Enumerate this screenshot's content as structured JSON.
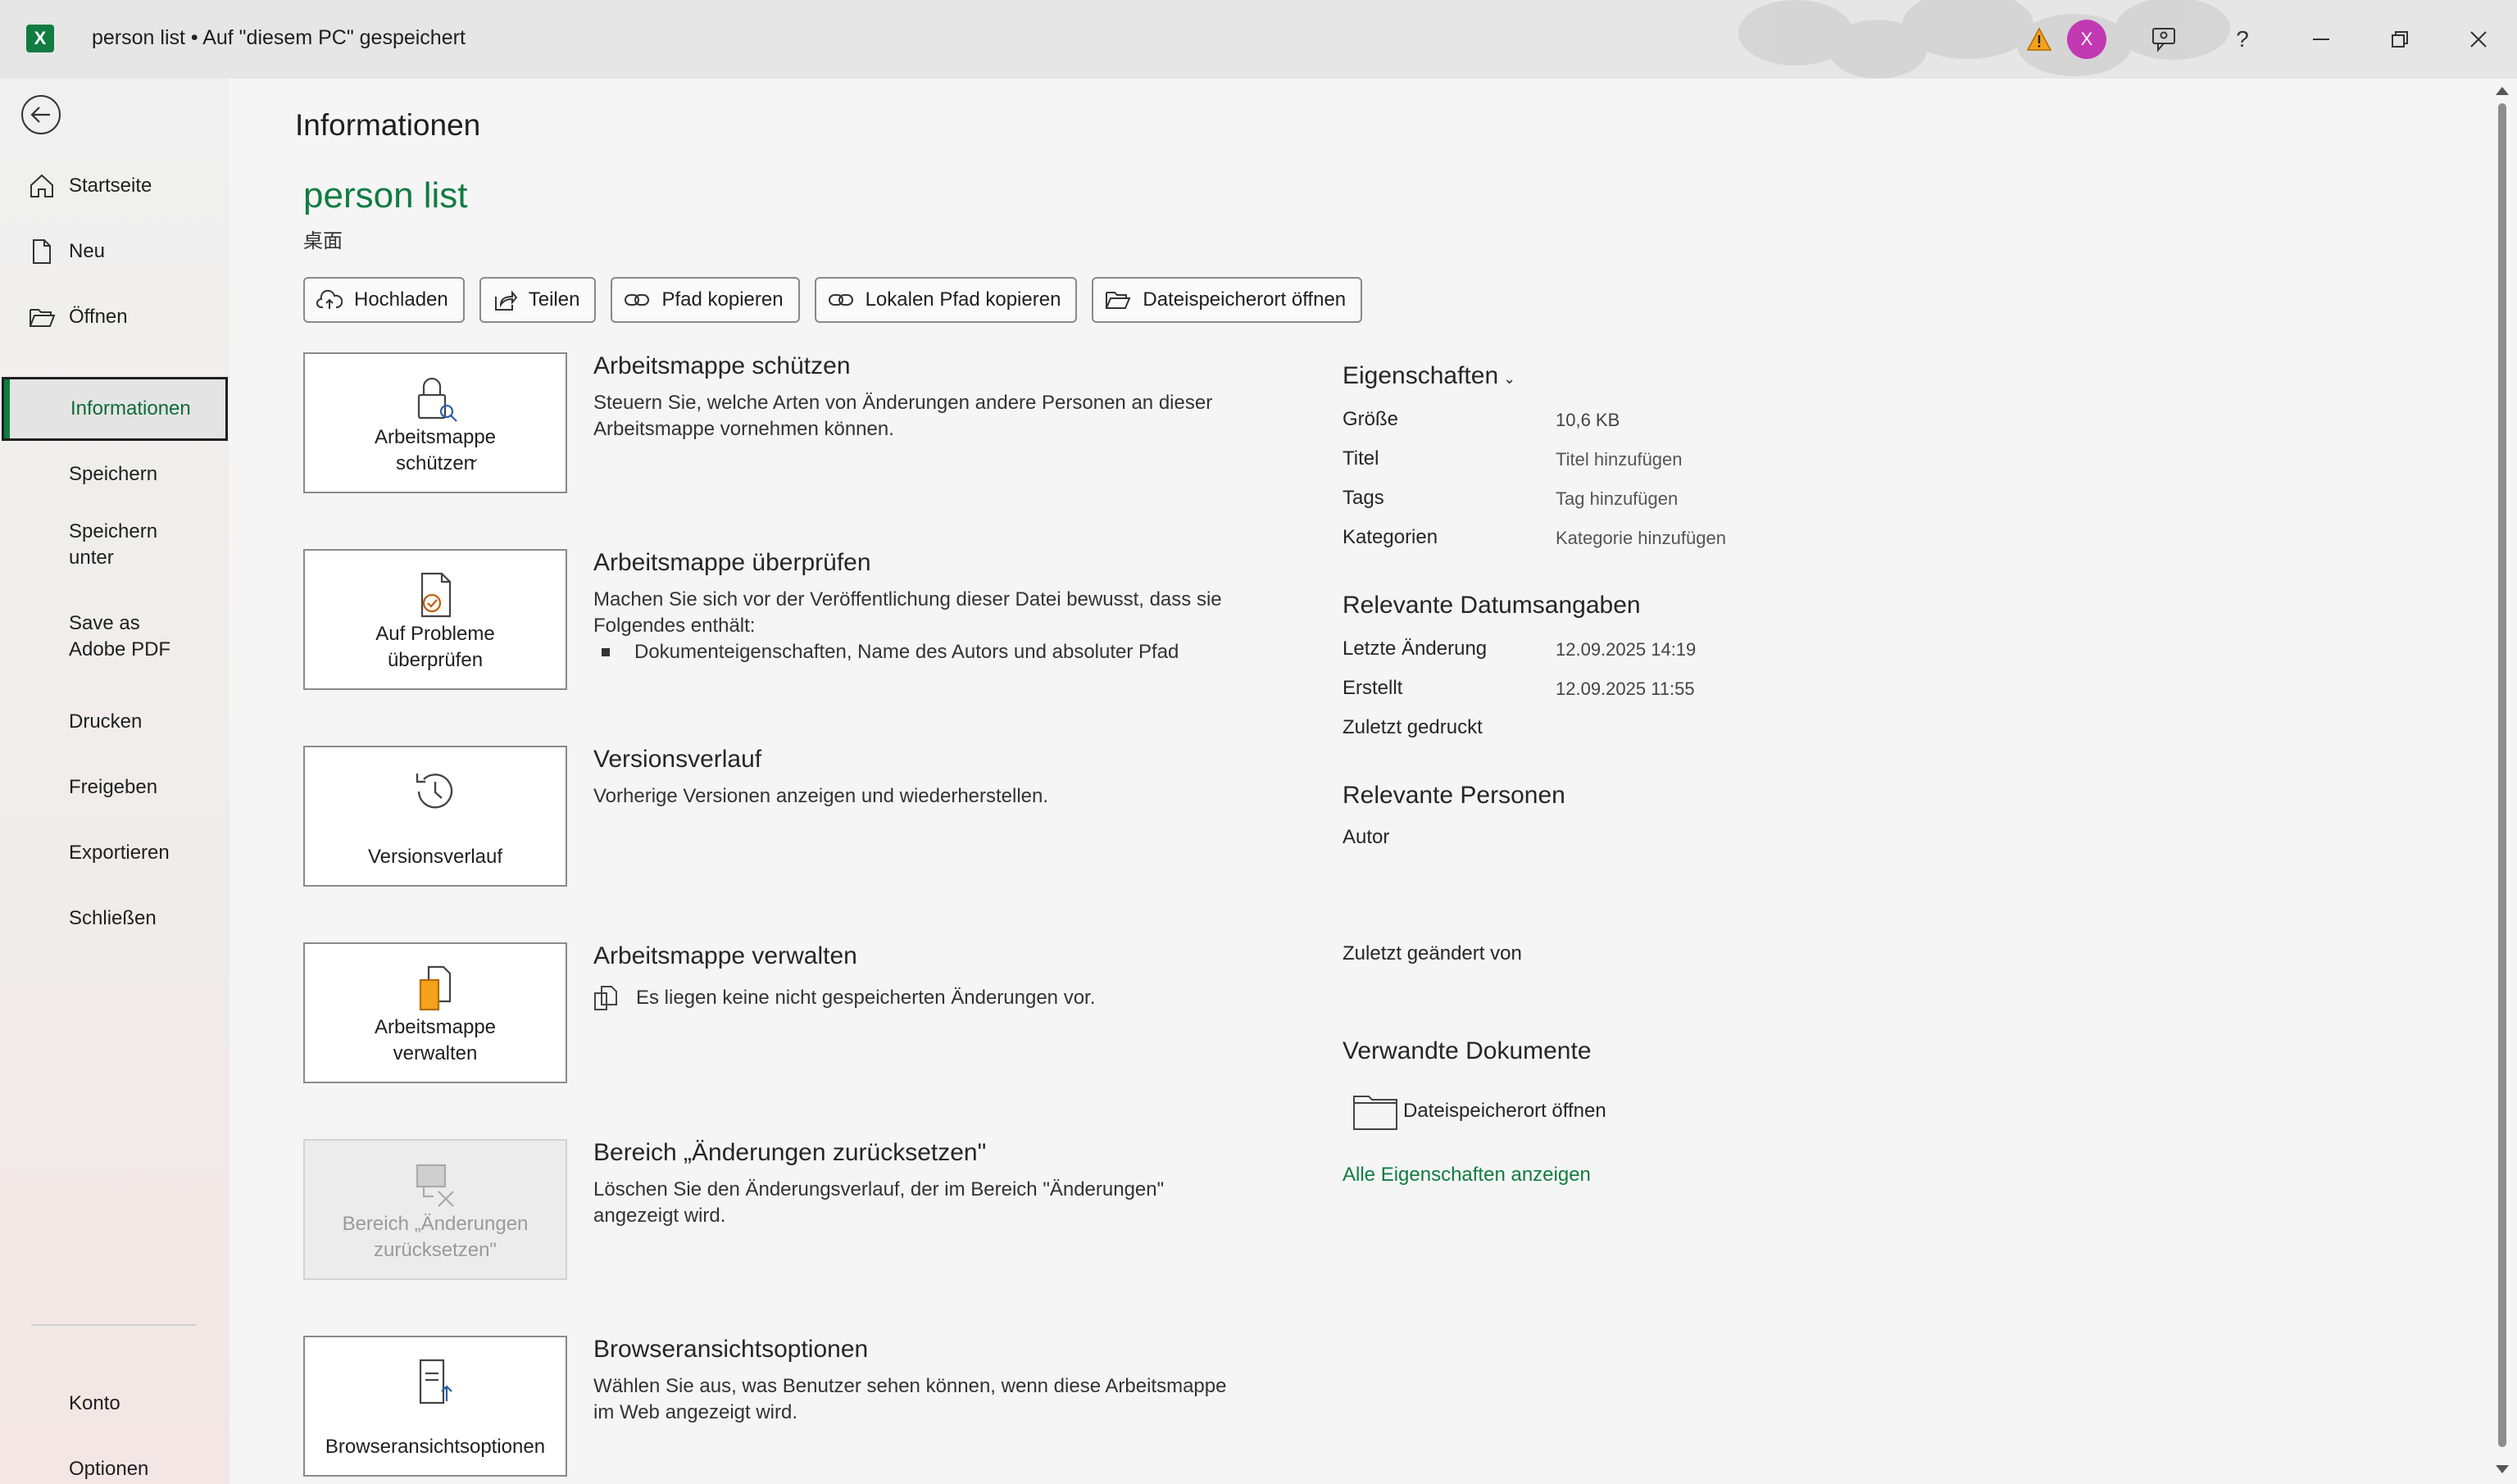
{
  "window": {
    "app_icon_letter": "X",
    "title": "person list  •  Auf \"diesem PC\" gespeichert",
    "avatar_letter": "X",
    "help_glyph": "?"
  },
  "sidebar": {
    "items": [
      {
        "label": "Startseite",
        "icon": "home-icon"
      },
      {
        "label": "Neu",
        "icon": "new-doc-icon"
      },
      {
        "label": "Öffnen",
        "icon": "folder-open-icon"
      },
      {
        "label": "Informationen"
      },
      {
        "label": "Speichern"
      },
      {
        "label": "Speichern unter"
      },
      {
        "label": "Save as Adobe PDF"
      },
      {
        "label": "Drucken"
      },
      {
        "label": "Freigeben"
      },
      {
        "label": "Exportieren"
      },
      {
        "label": "Schließen"
      },
      {
        "label": "Konto"
      },
      {
        "label": "Optionen"
      }
    ],
    "active": "Informationen"
  },
  "main": {
    "title": "Informationen",
    "doc_name": "person list",
    "doc_path": "桌面",
    "actions": [
      "Hochladen",
      "Teilen",
      "Pfad kopieren",
      "Lokalen Pfad kopieren",
      "Dateispeicherort öffnen"
    ],
    "sections": [
      {
        "card": "Arbeitsmappe schützen",
        "title": "Arbeitsmappe schützen",
        "desc": "Steuern Sie, welche Arten von Änderungen andere Personen an dieser Arbeitsmappe vornehmen können."
      },
      {
        "card": "Auf Probleme überprüfen",
        "title": "Arbeitsmappe überprüfen",
        "desc": "Machen Sie sich vor der Veröffentlichung dieser Datei bewusst, dass sie Folgendes enthält:",
        "bullet": "Dokumenteigenschaften, Name des Autors und absoluter Pfad"
      },
      {
        "card": "Versionsverlauf",
        "title": "Versionsverlauf",
        "desc": "Vorherige Versionen anzeigen und wiederherstellen."
      },
      {
        "card": "Arbeitsmappe verwalten",
        "title": "Arbeitsmappe verwalten",
        "desc": "Es liegen keine nicht gespeicherten Änderungen vor."
      },
      {
        "card": "Bereich „Änderungen zurücksetzen\"",
        "title": "Bereich „Änderungen zurücksetzen\"",
        "desc": "Löschen Sie den Änderungsverlauf, der im Bereich \"Änderungen\" angezeigt wird."
      },
      {
        "card": "Browseransichtsoptionen",
        "title": "Browseransichtsoptionen",
        "desc": "Wählen Sie aus, was Benutzer sehen können, wenn diese Arbeitsmappe im Web angezeigt wird."
      }
    ]
  },
  "properties": {
    "header": "Eigenschaften",
    "rows": [
      {
        "label": "Größe",
        "value": "10,6 KB"
      },
      {
        "label": "Titel",
        "value": "Titel hinzufügen"
      },
      {
        "label": "Tags",
        "value": "Tag hinzufügen"
      },
      {
        "label": "Kategorien",
        "value": "Kategorie hinzufügen"
      }
    ],
    "dates_header": "Relevante Datumsangaben",
    "dates": [
      {
        "label": "Letzte Änderung",
        "value": "12.09.2025 14:19"
      },
      {
        "label": "Erstellt",
        "value": "12.09.2025 11:55"
      },
      {
        "label": "Zuletzt gedruckt",
        "value": ""
      }
    ],
    "people_header": "Relevante Personen",
    "author_label": "Autor",
    "last_modified_by_label": "Zuletzt geändert von",
    "related_header": "Verwandte Dokumente",
    "related_item": "Dateispeicherort öffnen",
    "all_props_link": "Alle Eigenschaften anzeigen"
  },
  "colors": {
    "accent": "#107c41",
    "avatar": "#c239b3",
    "warning": "#f7a21b"
  }
}
